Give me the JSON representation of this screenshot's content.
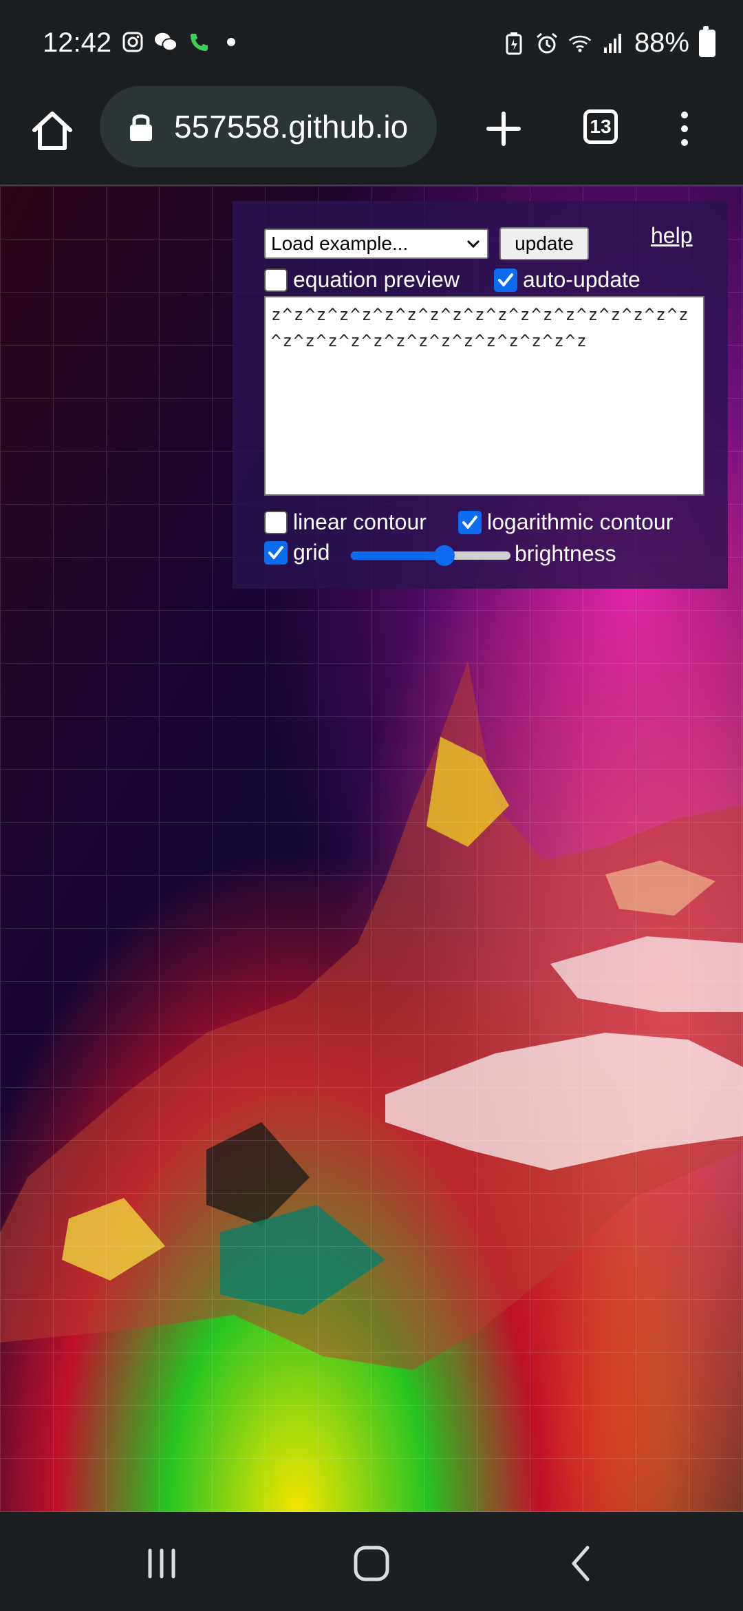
{
  "status_bar": {
    "time": "12:42",
    "battery": "88%",
    "left_icons": [
      "instagram-icon",
      "wechat-icon",
      "phone-icon",
      "dot-icon"
    ],
    "right_icons": [
      "battery-saver-icon",
      "alarm-icon",
      "wifi-icon",
      "signal-icon",
      "battery-icon"
    ]
  },
  "browser": {
    "url": "557558.github.io",
    "tab_count": "13"
  },
  "controls": {
    "example_select": "Load example...",
    "update_label": "update",
    "help_label": "help",
    "equation_preview_label": "equation preview",
    "equation_preview_checked": false,
    "auto_update_label": "auto-update",
    "auto_update_checked": true,
    "equation": "z^z^z^z^z^z^z^z^z^z^z^z^z^z^z^z^z^z^z^z^z^z^z^z^z^z^z^z^z^z^z^z^z",
    "linear_contour_label": "linear contour",
    "linear_contour_checked": false,
    "log_contour_label": "logarithmic contour",
    "log_contour_checked": true,
    "grid_label": "grid",
    "grid_checked": true,
    "brightness_label": "brightness",
    "brightness_value": 0.6
  },
  "colors": {
    "accent": "#0b6cf0",
    "panel_bg": "#281450"
  }
}
